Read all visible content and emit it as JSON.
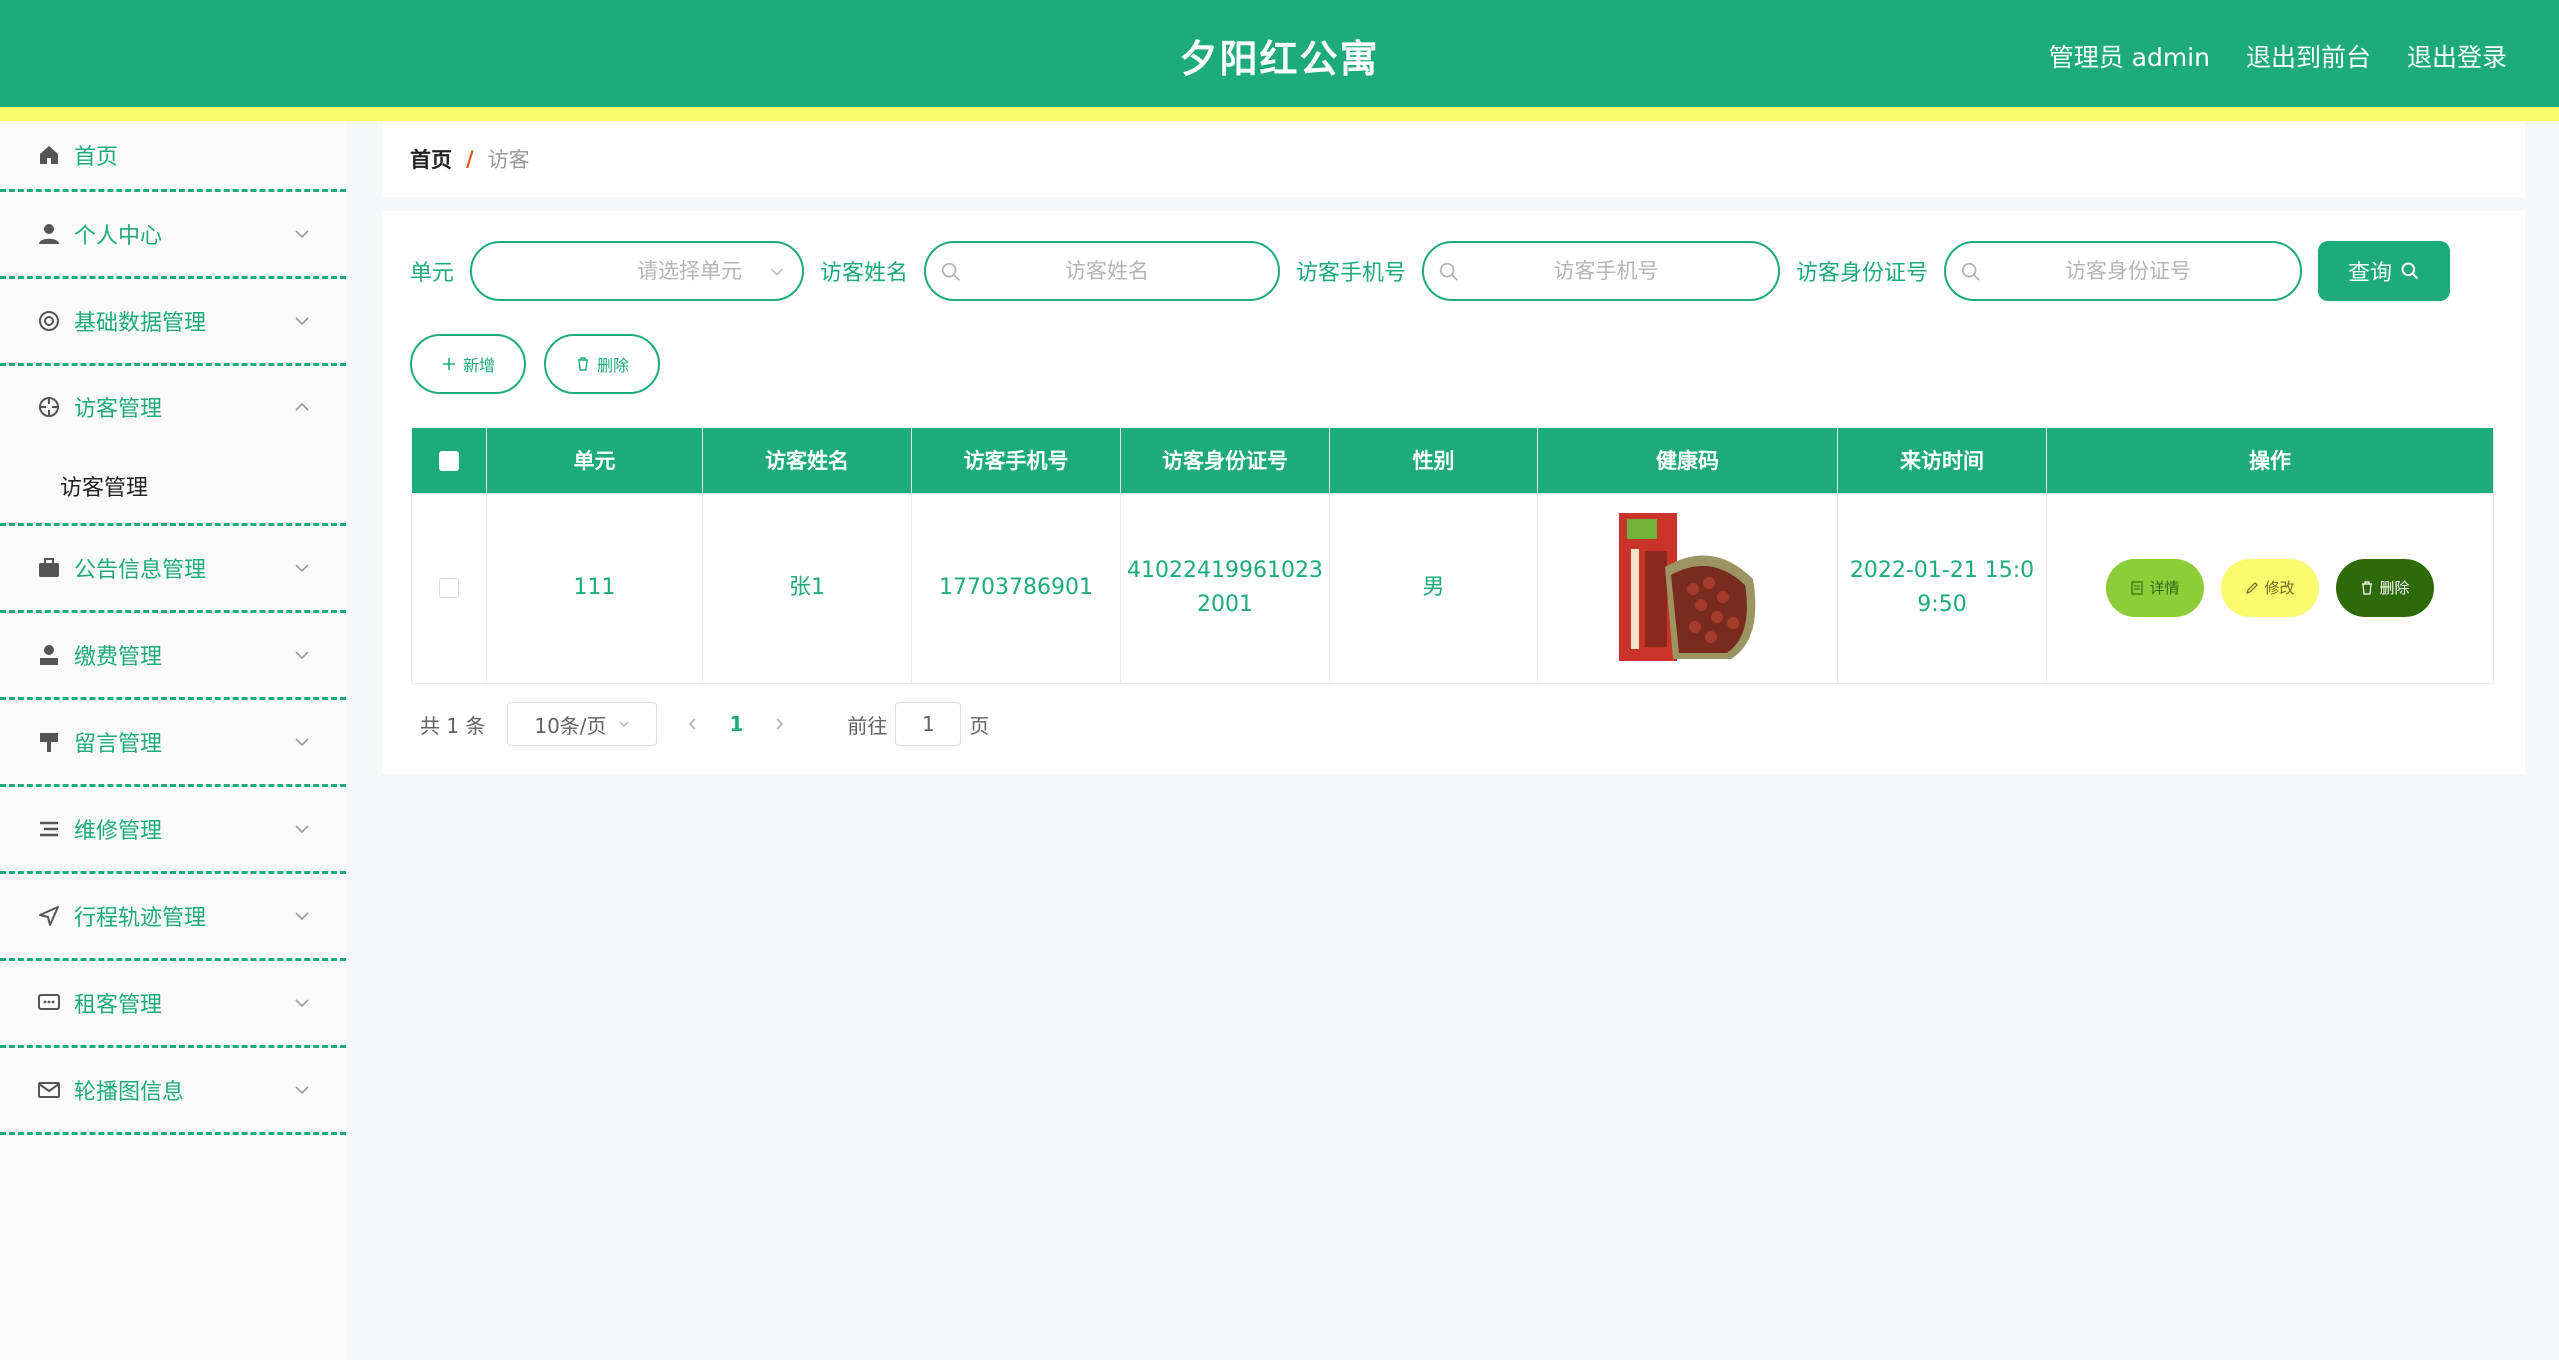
{
  "header": {
    "title": "夕阳红公寓",
    "user_label": "管理员 admin",
    "front_link": "退出到前台",
    "logout_link": "退出登录",
    "colors": {
      "primary": "#1dab7b",
      "accent_stripe": "#f9fa6c"
    }
  },
  "sidebar": {
    "items": [
      {
        "label": "首页",
        "icon": "home-icon"
      },
      {
        "label": "个人中心",
        "icon": "user-icon"
      },
      {
        "label": "基础数据管理",
        "icon": "lifebuoy-icon"
      },
      {
        "label": "访客管理",
        "icon": "crosshair-icon",
        "expanded": true
      },
      {
        "label": "公告信息管理",
        "icon": "briefcase-icon"
      },
      {
        "label": "缴费管理",
        "icon": "person-icon"
      },
      {
        "label": "留言管理",
        "icon": "brush-icon"
      },
      {
        "label": "维修管理",
        "icon": "list-icon"
      },
      {
        "label": "行程轨迹管理",
        "icon": "send-icon"
      },
      {
        "label": "租客管理",
        "icon": "chat-icon"
      },
      {
        "label": "轮播图信息",
        "icon": "mail-icon"
      }
    ],
    "sub_item": "访客管理"
  },
  "breadcrumb": {
    "home": "首页",
    "separator": "/",
    "current": "访客"
  },
  "search": {
    "unit_label": "单元",
    "unit_placeholder": "请选择单元",
    "name_label": "访客姓名",
    "name_placeholder": "访客姓名",
    "phone_label": "访客手机号",
    "phone_placeholder": "访客手机号",
    "idcard_label": "访客身份证号",
    "idcard_placeholder": "访客身份证号",
    "query_button": "查询"
  },
  "actions": {
    "add_button": "新增",
    "delete_button": "删除"
  },
  "table": {
    "columns": [
      "单元",
      "访客姓名",
      "访客手机号",
      "访客身份证号",
      "性别",
      "健康码",
      "来访时间",
      "操作"
    ],
    "rows": [
      {
        "unit": "111",
        "name": "张1",
        "phone": "17703786901",
        "idcard_line1": "41022419961023",
        "idcard_line2": "2001",
        "gender": "男",
        "health_code": "red-beans-package-image",
        "visit_time_line1": "2022-01-21 15:0",
        "visit_time_line2": "9:50",
        "detail_button": "详情",
        "edit_button": "修改",
        "delete_button": "删除"
      }
    ]
  },
  "pagination": {
    "total": "共 1 条",
    "page_size": "10条/页",
    "current_page": "1",
    "goto_label": "前往",
    "goto_value": "1",
    "page_suffix": "页"
  }
}
